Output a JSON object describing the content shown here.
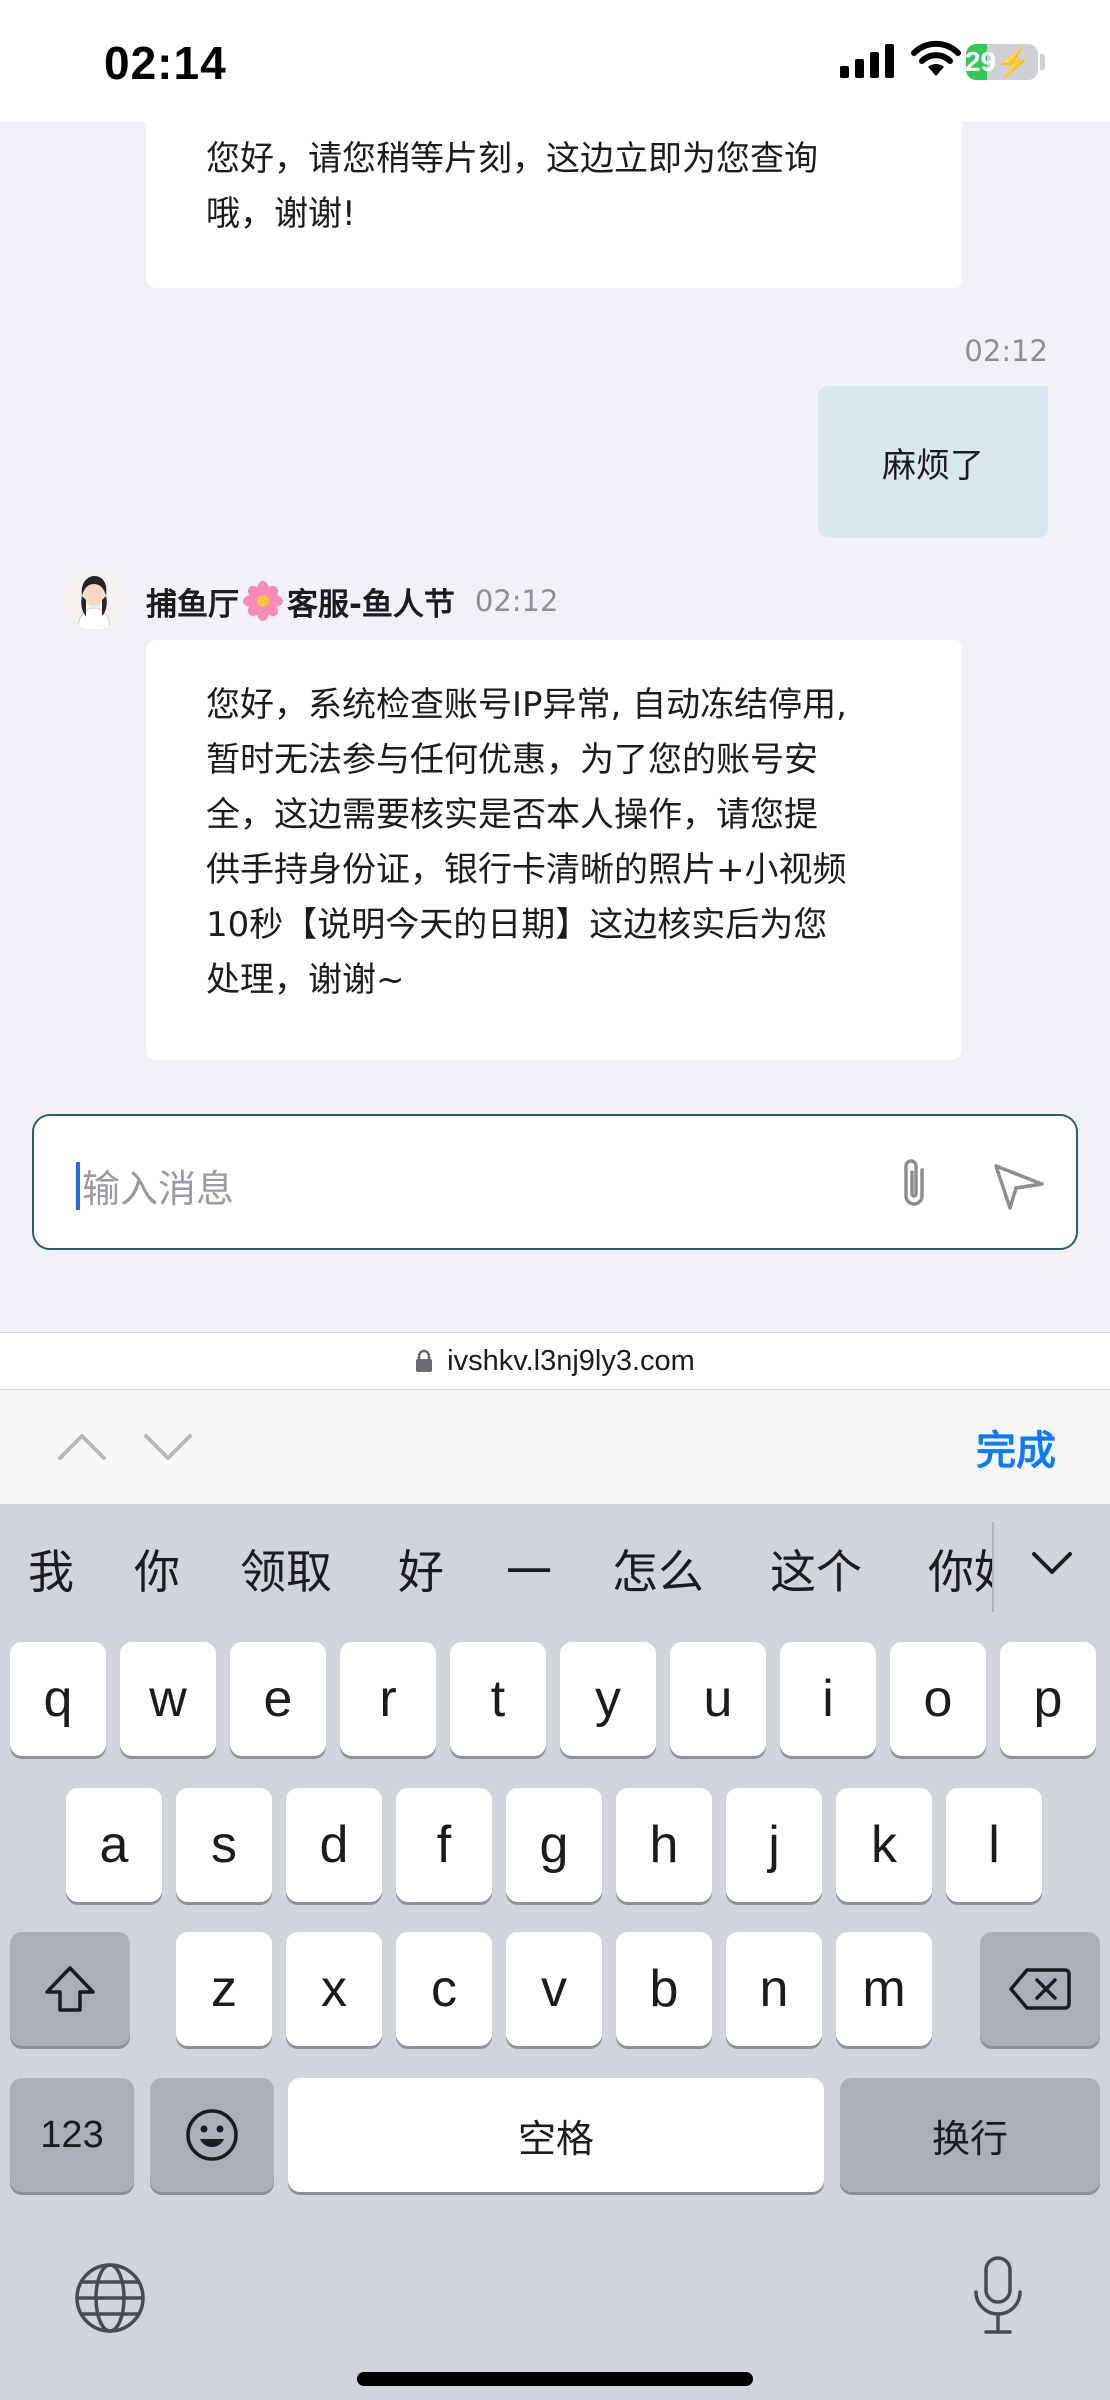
{
  "status_bar": {
    "time": "02:14",
    "battery_level": "29",
    "battery_fraction": 0.29
  },
  "chat": {
    "messages": [
      {
        "lines": [
          "您好，请您稍等片刻，这边立即为您查询",
          "哦，谢谢!"
        ]
      },
      {
        "time": "02:12",
        "text": "麻烦了"
      },
      {
        "sender_name": "捕鱼厅",
        "sender_suffix": "客服-鱼人节",
        "time": "02:12",
        "lines": [
          "您好，系统检查账号IP异常, 自动冻结停用,",
          "暂时无法参与任何优惠，为了您的账号安",
          "全，这边需要核实是否本人操作，请您提",
          "供手持身份证，银行卡清晰的照片+小视频",
          "10秒【说明今天的日期】这边核实后为您",
          "处理，谢谢~"
        ]
      }
    ],
    "input": {
      "placeholder": "输入消息"
    }
  },
  "browser": {
    "url": "ivshkv.l3nj9ly3.com"
  },
  "toolbar": {
    "done_label": "完成"
  },
  "keyboard": {
    "candidates": [
      "我",
      "你",
      "领取",
      "好",
      "一",
      "怎么",
      "这个",
      "你好"
    ],
    "row1": [
      "q",
      "w",
      "e",
      "r",
      "t",
      "y",
      "u",
      "i",
      "o",
      "p"
    ],
    "row2": [
      "a",
      "s",
      "d",
      "f",
      "g",
      "h",
      "j",
      "k",
      "l"
    ],
    "row3": [
      "z",
      "x",
      "c",
      "v",
      "b",
      "n",
      "m"
    ],
    "numbers_label": "123",
    "space_label": "空格",
    "return_label": "换行"
  },
  "colors": {
    "accent": "#0a7aff",
    "outgoing_bubble": "#d9e8ef",
    "input_border": "#2c5b77",
    "battery": "#34c759"
  }
}
